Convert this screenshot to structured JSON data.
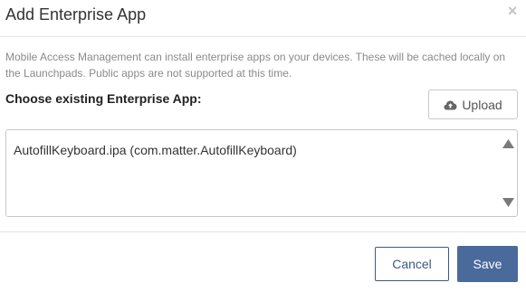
{
  "modal": {
    "title": "Add Enterprise App",
    "close_glyph": "×"
  },
  "description": "Mobile Access Management can install enterprise apps on your devices. These will be cached locally on the Launchpads. Public apps are not supported at this time.",
  "chooser": {
    "label": "Choose existing Enterprise App:",
    "upload_label": "Upload",
    "upload_icon": "cloud-upload-icon",
    "options": [
      "AutofillKeyboard.ipa (com.matter.AutofillKeyboard)"
    ]
  },
  "footer": {
    "cancel_label": "Cancel",
    "save_label": "Save"
  },
  "colors": {
    "primary": "#4a6a9c",
    "cancel_border": "#3d5a86",
    "muted_text": "#8a8a8a"
  }
}
